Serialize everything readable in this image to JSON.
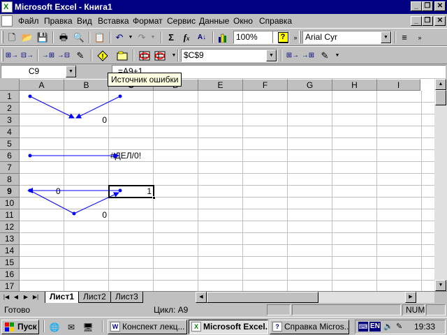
{
  "window": {
    "title": "Microsoft Excel - Книга1",
    "icon": "excel-icon"
  },
  "menu": {
    "items": [
      "Файл",
      "Правка",
      "Вид",
      "Вставка",
      "Формат",
      "Сервис",
      "Данные",
      "Окно",
      "Справка"
    ]
  },
  "standard_toolbar": {
    "zoom": "100%",
    "font": "Arial Cyr",
    "icons": [
      "new-icon",
      "open-icon",
      "save-icon",
      "print-icon",
      "print-preview-icon",
      "paste-icon",
      "undo-icon",
      "redo-icon",
      "autosum-icon",
      "function-icon",
      "sort-icon",
      "chart-wizard-icon",
      "help-icon",
      "align-icon"
    ]
  },
  "audit_toolbar": {
    "cell_ref": "$C$9",
    "icons": [
      "trace-precedents-icon",
      "remove-precedents-icon",
      "trace-dependents-icon",
      "remove-dependents-icon",
      "remove-all-arrows-icon",
      "trace-error-icon",
      "new-comment-icon",
      "circle-invalid-icon",
      "clear-circles-icon",
      "show-watch-icon",
      "evaluate-icon"
    ]
  },
  "formula_bar": {
    "name_box": "C9",
    "formula": "=A9+1",
    "tooltip": "Источник ошибки"
  },
  "grid": {
    "columns": [
      "A",
      "B",
      "C",
      "D",
      "E",
      "F",
      "G",
      "H",
      "I"
    ],
    "rows": [
      "1",
      "2",
      "3",
      "4",
      "5",
      "6",
      "7",
      "8",
      "9",
      "10",
      "11",
      "12",
      "13",
      "14",
      "15",
      "16",
      "17"
    ],
    "selected_cell": "C9",
    "cells": {
      "B3": "0",
      "C6": "#ДЕЛ/0!",
      "B9": "0",
      "C9": "1",
      "B11": "0"
    },
    "arrow_color": "#0000ff"
  },
  "sheets": {
    "tabs": [
      "Лист1",
      "Лист2",
      "Лист3"
    ],
    "active": "Лист1"
  },
  "status": {
    "ready": "Готово",
    "cycle": "Цикл: A9",
    "num": "NUM"
  },
  "taskbar": {
    "start": "Пуск",
    "tasks": [
      "Конспект лекц...",
      "Microsoft Excel...",
      "Справка Micros..."
    ],
    "active_task": "Microsoft Excel...",
    "lang": "EN",
    "clock": "19:33"
  }
}
